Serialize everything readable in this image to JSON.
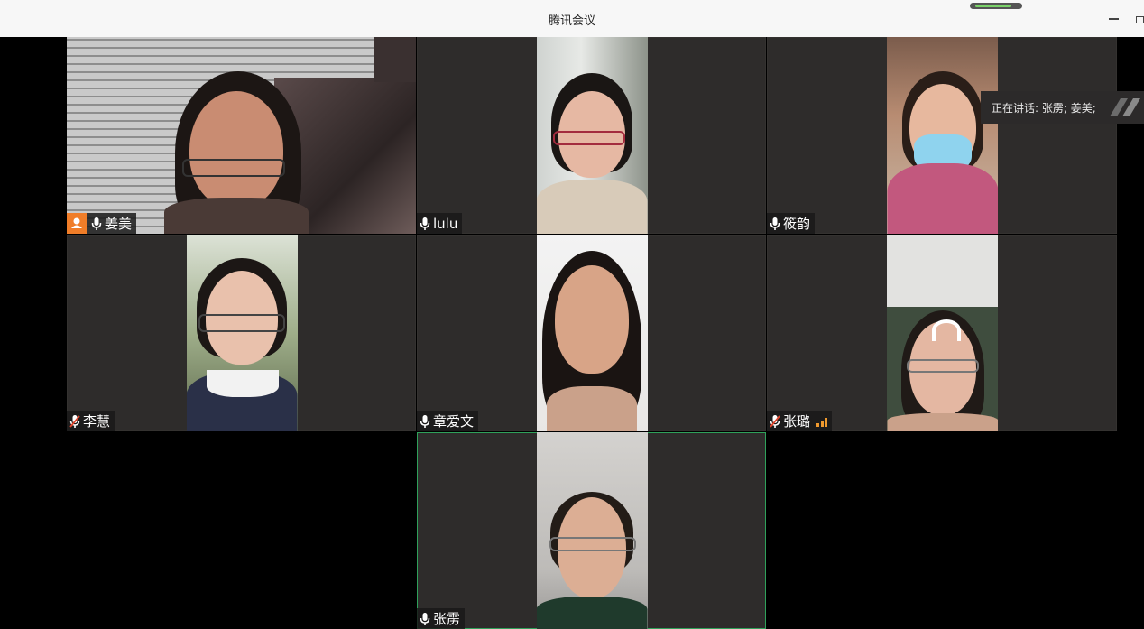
{
  "window": {
    "title": "腾讯会议",
    "network_quality": 0.85
  },
  "speaking_now": "正在讲话: 张雳; 姜美;",
  "participants": [
    {
      "name": "姜美",
      "mic": "on",
      "host": true
    },
    {
      "name": "lulu",
      "mic": "on"
    },
    {
      "name": "筱韵",
      "mic": "on"
    },
    {
      "name": "李慧",
      "mic": "muted"
    },
    {
      "name": "章爱文",
      "mic": "on"
    },
    {
      "name": "张璐",
      "mic": "muted",
      "signal": 3
    },
    {
      "name": "张雳",
      "mic": "on",
      "active": true
    }
  ],
  "colors": {
    "host_badge": "#f07d28",
    "active_border": "#2fa15a",
    "muted_slash": "#e0452c",
    "signal": "#f09a2e"
  }
}
